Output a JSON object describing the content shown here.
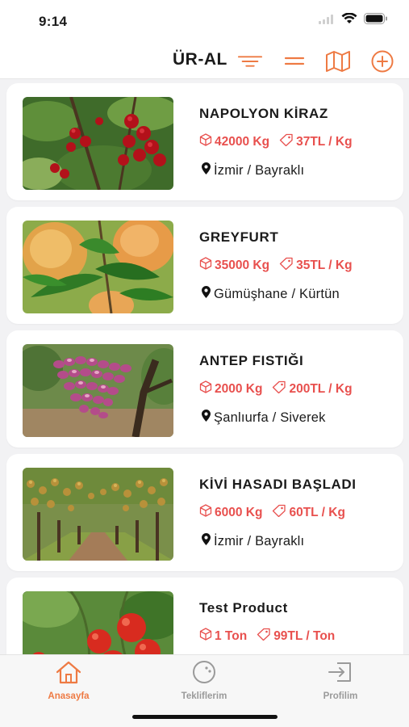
{
  "status_bar": {
    "time": "9:14"
  },
  "header": {
    "title": "ÜR-AL",
    "icons": [
      "filter-icon",
      "menu-icon",
      "map-icon",
      "add-circle-icon"
    ],
    "accent_color": "#EE7A43"
  },
  "products": [
    {
      "title": "NAPOLYON KİRAZ",
      "quantity": "42000 Kg",
      "price": "37TL / Kg",
      "location": "İzmir / Bayraklı",
      "image": "cherry-tree-photo"
    },
    {
      "title": "GREYFURT",
      "quantity": "35000 Kg",
      "price": "35TL / Kg",
      "location": "Gümüşhane / Kürtün",
      "image": "grapefruit-tree-photo"
    },
    {
      "title": "ANTEP FISTIĞI",
      "quantity": "2000 Kg",
      "price": "200TL / Kg",
      "location": "Şanlıurfa / Siverek",
      "image": "pistachio-cluster-photo"
    },
    {
      "title": "KİVİ HASADI BAŞLADI",
      "quantity": "6000 Kg",
      "price": "60TL / Kg",
      "location": "İzmir / Bayraklı",
      "image": "kiwi-orchard-photo"
    },
    {
      "title": "Test Product",
      "quantity": "1 Ton",
      "price": "99TL / Ton",
      "location": "",
      "image": "tomato-plant-photo"
    }
  ],
  "tab_bar": {
    "tabs": [
      {
        "label": "Anasayfa",
        "icon": "home-icon",
        "active": true
      },
      {
        "label": "Tekliflerim",
        "icon": "offers-icon",
        "active": false
      },
      {
        "label": "Profilim",
        "icon": "login-icon",
        "active": false
      }
    ]
  },
  "colors": {
    "price_red": "#E8504E",
    "accent_orange": "#EE7A43",
    "inactive_gray": "#9A9A9A"
  }
}
